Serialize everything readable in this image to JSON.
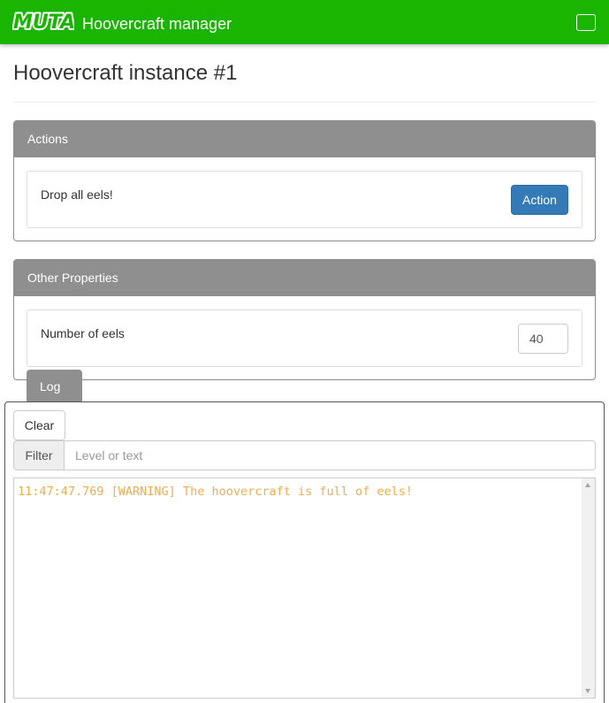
{
  "navbar": {
    "logo_text": "MUTA",
    "app_title": "Hoovercraft manager",
    "toggle_icon": "menu-toggle-icon"
  },
  "page": {
    "title": "Hoovercraft instance #1"
  },
  "actions_panel": {
    "heading": "Actions",
    "items": [
      {
        "label": "Drop all eels!",
        "button_label": "Action"
      }
    ]
  },
  "properties_panel": {
    "heading": "Other Properties",
    "items": [
      {
        "label": "Number of eels",
        "value": "40"
      }
    ]
  },
  "log": {
    "tab_label": "Log",
    "clear_label": "Clear",
    "filter_label": "Filter",
    "filter_placeholder": "Level or text",
    "entries": [
      {
        "time": "11:47:47.769",
        "level": "WARNING",
        "message": "The hoovercraft is full of eels!",
        "text": "11:47:47.769 [WARNING] The hoovercraft is full of eels!"
      }
    ]
  },
  "colors": {
    "navbar": "#19b500",
    "panel_heading": "#8f8f8f",
    "primary_button": "#337ab7",
    "warning_text": "#f0ad4e"
  }
}
